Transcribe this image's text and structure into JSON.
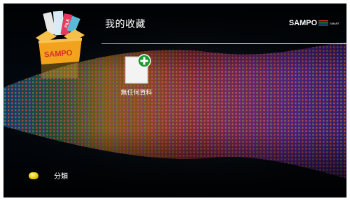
{
  "header": {
    "title": "我的收藏",
    "brand": "SAMPO",
    "brand_sub": "SMART"
  },
  "app_icon": {
    "box_label": "SAMPO",
    "paper_label": "FILE"
  },
  "content": {
    "empty_tile": {
      "label": "無任何資料",
      "icon": "add-document-icon"
    }
  },
  "footer": {
    "category": {
      "button_icon": "yellow-button-icon",
      "label": "分類"
    }
  },
  "colors": {
    "background": "#02070d",
    "text": "#ffffff",
    "accent_green": "#1f9a2e",
    "button_yellow": "#f3d316",
    "box_orange": "#f2a21c",
    "box_red": "#d4302a"
  }
}
